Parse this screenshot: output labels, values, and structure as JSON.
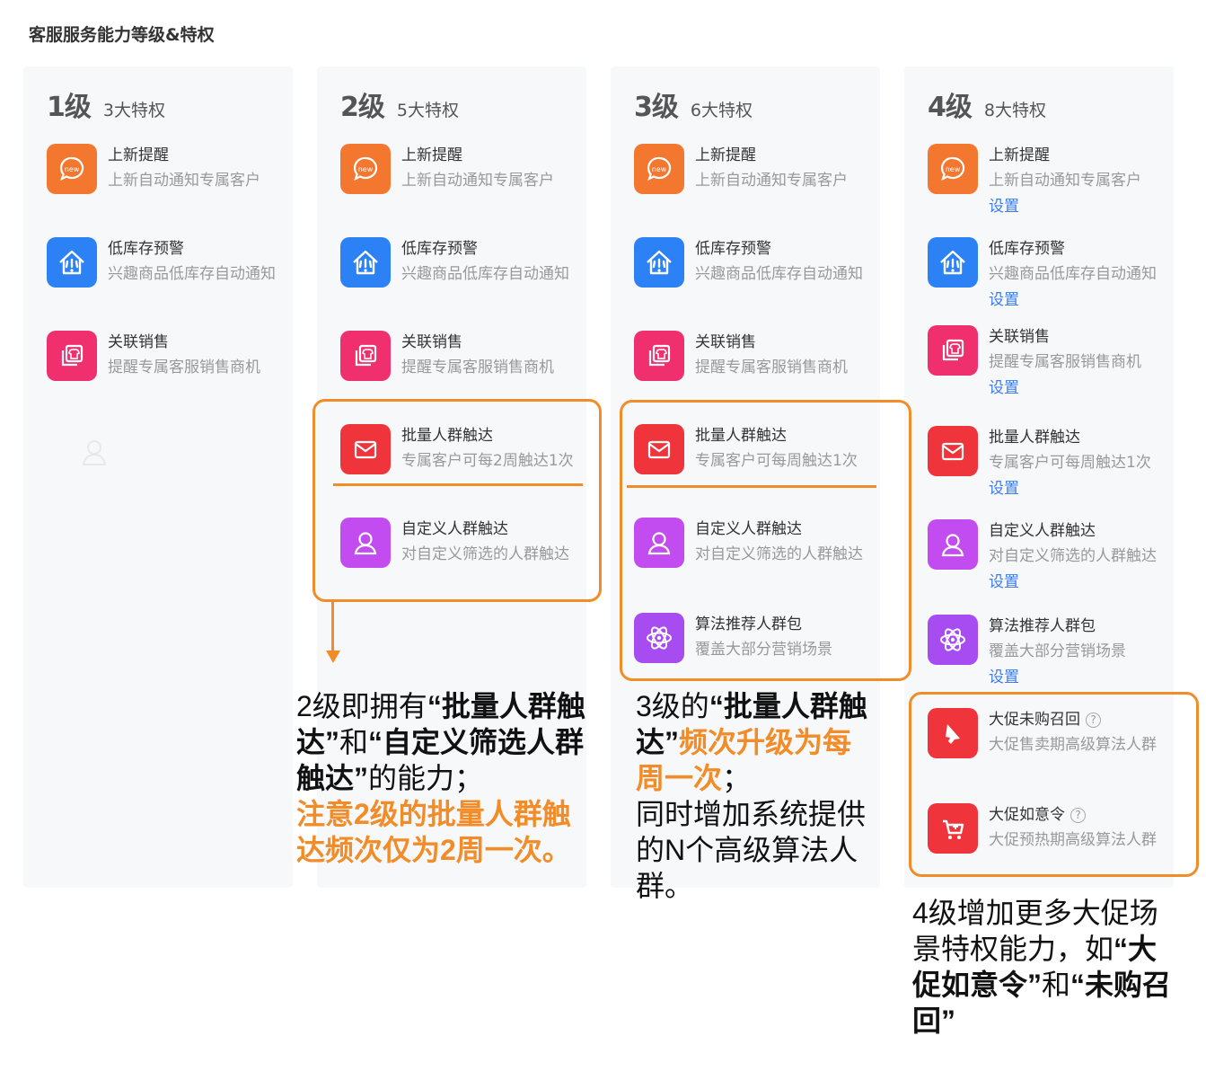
{
  "page": {
    "title": "客服服务能力等级&特权"
  },
  "levels": [
    {
      "level": "1级",
      "count": "3大特权",
      "privileges": [
        {
          "title": "上新提醒",
          "desc": "上新自动通知专属客户",
          "icon": "new-bubble-icon",
          "color": "#f4772f"
        },
        {
          "title": "低库存预警",
          "desc": "兴趣商品低库存自动通知",
          "icon": "house-alert-icon",
          "color": "#2c82f5"
        },
        {
          "title": "关联销售",
          "desc": "提醒专属客服销售商机",
          "icon": "shirt-stack-icon",
          "color": "#f0306e"
        }
      ]
    },
    {
      "level": "2级",
      "count": "5大特权",
      "privileges": [
        {
          "title": "上新提醒",
          "desc": "上新自动通知专属客户",
          "icon": "new-bubble-icon",
          "color": "#f4772f"
        },
        {
          "title": "低库存预警",
          "desc": "兴趣商品低库存自动通知",
          "icon": "house-alert-icon",
          "color": "#2c82f5"
        },
        {
          "title": "关联销售",
          "desc": "提醒专属客服销售商机",
          "icon": "shirt-stack-icon",
          "color": "#f0306e"
        },
        {
          "title": "批量人群触达",
          "desc": "专属客户可每2周触达1次",
          "icon": "mail-icon",
          "color": "#f0343c"
        },
        {
          "title": "自定义人群触达",
          "desc": "对自定义筛选的人群触达",
          "icon": "person-icon",
          "color": "#c34cf0"
        }
      ]
    },
    {
      "level": "3级",
      "count": "6大特权",
      "privileges": [
        {
          "title": "上新提醒",
          "desc": "上新自动通知专属客户",
          "icon": "new-bubble-icon",
          "color": "#f4772f"
        },
        {
          "title": "低库存预警",
          "desc": "兴趣商品低库存自动通知",
          "icon": "house-alert-icon",
          "color": "#2c82f5"
        },
        {
          "title": "关联销售",
          "desc": "提醒专属客服销售商机",
          "icon": "shirt-stack-icon",
          "color": "#f0306e"
        },
        {
          "title": "批量人群触达",
          "desc": "专属客户可每周触达1次",
          "icon": "mail-icon",
          "color": "#f0343c"
        },
        {
          "title": "自定义人群触达",
          "desc": "对自定义筛选的人群触达",
          "icon": "person-icon",
          "color": "#c34cf0"
        },
        {
          "title": "算法推荐人群包",
          "desc": "覆盖大部分营销场景",
          "icon": "atom-icon",
          "color": "#a64cf0"
        }
      ]
    },
    {
      "level": "4级",
      "count": "8大特权",
      "link_label": "设置",
      "privileges": [
        {
          "title": "上新提醒",
          "desc": "上新自动通知专属客户",
          "icon": "new-bubble-icon",
          "color": "#f4772f"
        },
        {
          "title": "低库存预警",
          "desc": "兴趣商品低库存自动通知",
          "icon": "house-alert-icon",
          "color": "#2c82f5"
        },
        {
          "title": "关联销售",
          "desc": "提醒专属客服销售商机",
          "icon": "shirt-stack-icon",
          "color": "#f0306e"
        },
        {
          "title": "批量人群触达",
          "desc": "专属客户可每周触达1次",
          "icon": "mail-icon",
          "color": "#f0343c"
        },
        {
          "title": "自定义人群触达",
          "desc": "对自定义筛选的人群触达",
          "icon": "person-icon",
          "color": "#c34cf0"
        },
        {
          "title": "算法推荐人群包",
          "desc": "覆盖大部分营销场景",
          "icon": "atom-icon",
          "color": "#a64cf0"
        },
        {
          "title": "大促未购召回",
          "desc": "大促售卖期高级算法人群",
          "icon": "megaphone-icon",
          "color": "#f0343c"
        },
        {
          "title": "大促如意令",
          "desc": "大促预热期高级算法人群",
          "icon": "cart-icon",
          "color": "#f0343c"
        }
      ]
    }
  ],
  "notes": {
    "level2": {
      "p1": "2级即拥有",
      "q1": "“批量人群触达”",
      "p2": "和",
      "q2": "“自定义筛选人群触达”",
      "p3": "的能力；",
      "warn": "注意2级的批量人群触达频次仅为2周一次。"
    },
    "level3": {
      "p1": "3级的",
      "q1": "“批量人群触达”",
      "hl": "频次升级为每周一次",
      "p2": "；",
      "p3": "同时增加系统提供的N个高级算法人群。"
    },
    "level4": {
      "p1": "4级增加更多大促场景特权能力，如",
      "q1": "“大促如意令”",
      "p2": "和",
      "q2": "“未购召回”"
    }
  },
  "colors": {
    "highlight": "#f28c28",
    "link": "#3a7bf0"
  }
}
